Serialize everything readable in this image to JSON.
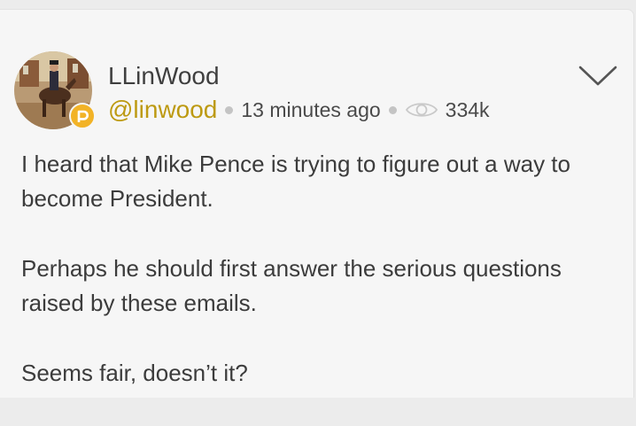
{
  "post": {
    "author": {
      "display_name": "LLinWood",
      "handle": "@linwood",
      "avatar_icon": "avatar-image",
      "badge_icon": "platform-badge-icon",
      "handle_color": "#bd9a12"
    },
    "timestamp": "13 minutes ago",
    "views": "334k",
    "views_icon": "eye-icon",
    "menu_icon": "chevron-down-icon",
    "paragraphs": [
      "I heard that Mike Pence is trying to figure out a way to become President.",
      "Perhaps he should first answer the serious questions raised by these emails.",
      "Seems fair, doesn’t it?"
    ]
  },
  "colors": {
    "background": "#f6f6f6",
    "text": "#3c3c3c",
    "accent": "#f2b327"
  }
}
